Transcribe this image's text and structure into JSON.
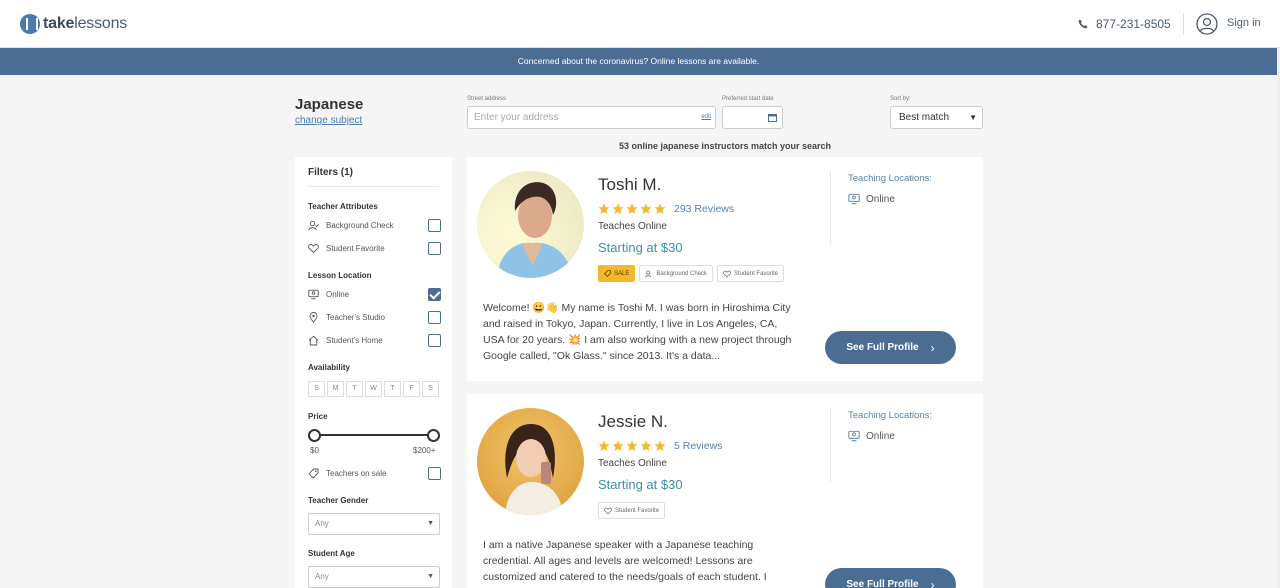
{
  "header": {
    "logo_text_bold": "take",
    "logo_text_rest": "lessons",
    "phone": "877-231-8505",
    "signin": "Sign in"
  },
  "banner": {
    "text": "Concerned about the coronavirus? Online lessons are available."
  },
  "search": {
    "subject": "Japanese",
    "change_subject": "change subject",
    "street_label": "Street address",
    "street_placeholder": "Enter your address",
    "edit_label": "edit",
    "date_label": "Preferred start date",
    "sort_label": "Sort by:",
    "sort_value": "Best match",
    "match_count": "53 online japanese instructors match your search"
  },
  "filters": {
    "title": "Filters (1)",
    "teacher_attributes": {
      "heading": "Teacher Attributes",
      "items": [
        {
          "label": "Background Check",
          "checked": false
        },
        {
          "label": "Student Favorite",
          "checked": false
        }
      ]
    },
    "lesson_location": {
      "heading": "Lesson Location",
      "items": [
        {
          "label": "Online",
          "checked": true
        },
        {
          "label": "Teacher's Studio",
          "checked": false
        },
        {
          "label": "Student's Home",
          "checked": false
        }
      ]
    },
    "availability": {
      "heading": "Availability",
      "days": [
        "S",
        "M",
        "T",
        "W",
        "T",
        "F",
        "S"
      ]
    },
    "price": {
      "heading": "Price",
      "min_label": "$0",
      "max_label": "$200+",
      "sale_label": "Teachers on sale"
    },
    "gender": {
      "heading": "Teacher Gender",
      "value": "Any"
    },
    "age": {
      "heading": "Student Age",
      "value": "Any"
    }
  },
  "teachers": [
    {
      "name": "Toshi M.",
      "rating": 5,
      "reviews": "293 Reviews",
      "teaches": "Teaches Online",
      "price": "Starting at $30",
      "badges": [
        "SALE",
        "Background Check",
        "Student Favorite"
      ],
      "locations_title": "Teaching Locations:",
      "location": "Online",
      "bio": "Welcome! 😀👋 My name is Toshi M. I was born in Hiroshima City and raised in Tokyo, Japan. Currently, I live in Los Angeles, CA, USA for 20 years. 💥 I am also working with a new project through Google called, \"Ok Glass.\" since 2013. It's a data...",
      "button": "See Full Profile"
    },
    {
      "name": "Jessie N.",
      "rating": 5,
      "reviews": "5 Reviews",
      "teaches": "Teaches Online",
      "price": "Starting at $30",
      "badges": [
        "Student Favorite"
      ],
      "locations_title": "Teaching Locations:",
      "location": "Online",
      "bio": "I am a native Japanese speaker with a Japanese teaching credential. All ages and levels are welcomed! Lessons are customized and catered to the needs/goals of each student. I",
      "button": "See Full Profile"
    }
  ],
  "colors": {
    "brand": "#4b6d93",
    "link": "#4a7ab0",
    "price": "#3f8fa0",
    "star": "#f4b82d",
    "sale": "#f4b82d"
  }
}
